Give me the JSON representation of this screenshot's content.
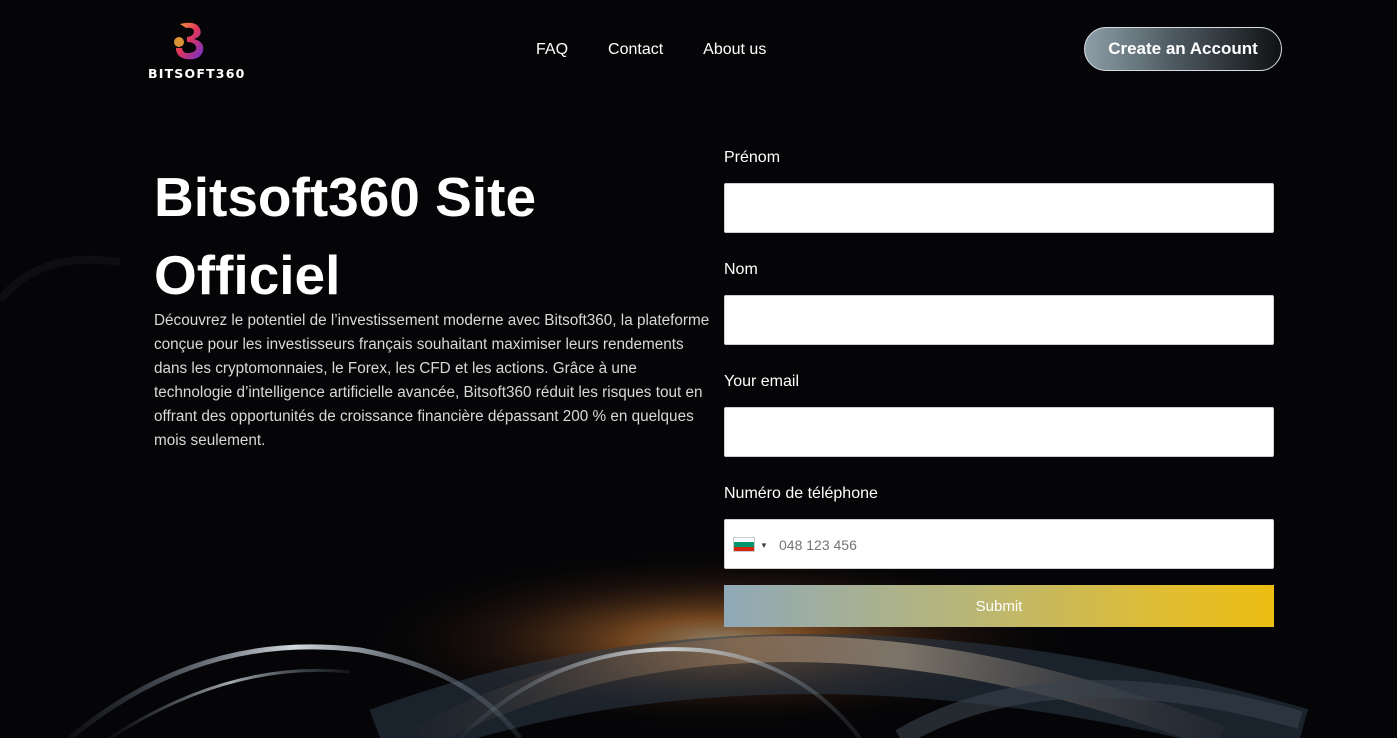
{
  "header": {
    "logo_text": "BITSOFT360",
    "nav": [
      {
        "label": "FAQ"
      },
      {
        "label": "Contact"
      },
      {
        "label": "About us"
      }
    ],
    "cta_label": "Create an Account"
  },
  "hero": {
    "title": "Bitsoft360 Site Officiel",
    "description": "Découvrez le potentiel de l’investissement moderne avec Bitsoft360, la plateforme conçue pour les investisseurs français souhaitant maximiser leurs rendements dans les cryptomonnaies, le Forex, les CFD et les actions. Grâce à une technologie d’intelligence artificielle avancée, Bitsoft360 réduit les risques tout en offrant des opportunités de croissance financière dépassant 200 % en quelques mois seulement."
  },
  "form": {
    "first_name_label": "Prénom",
    "last_name_label": "Nom",
    "email_label": "Your email",
    "phone_label": "Numéro de téléphone",
    "phone_placeholder": "048 123 456",
    "phone_flag": "bulgaria-flag-icon",
    "submit_label": "Submit"
  },
  "colors": {
    "background": "#050507",
    "accent_gold": "#ecbd12",
    "accent_steel": "#8fa9b8"
  }
}
